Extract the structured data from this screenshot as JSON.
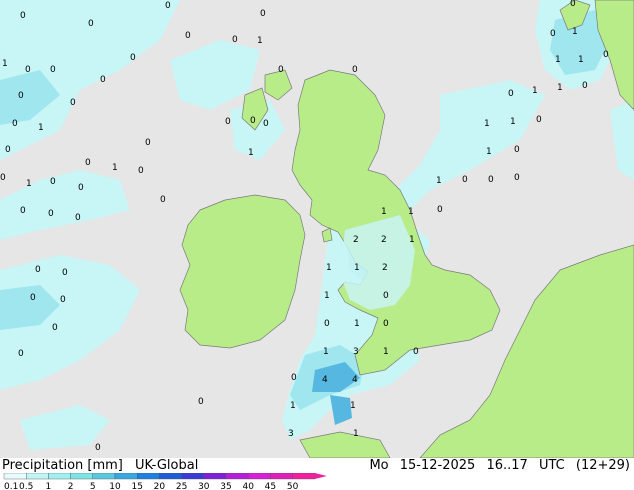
{
  "header": {
    "title": "Precipitation [mm]",
    "model": "UK-Global",
    "day": "Mo",
    "date": "15-12-2025",
    "hours": "16..17",
    "timezone": "UTC",
    "offset": "(12+29)"
  },
  "legend": {
    "ticks": [
      "0.1",
      "0.5",
      "1",
      "2",
      "5",
      "10",
      "15",
      "20",
      "25",
      "30",
      "35",
      "40",
      "45",
      "50"
    ],
    "colors": [
      "#e6fcfc",
      "#bff5f5",
      "#a0f0f0",
      "#7de3e3",
      "#55c9e0",
      "#38a8e0",
      "#1e80df",
      "#1e5cd6",
      "#3a3ad6",
      "#7f1fd6",
      "#b31fd6",
      "#d61fd6",
      "#e01fb8",
      "#f01fa0"
    ]
  },
  "colors": {
    "land": "#b8ec88",
    "sea": "#e6e6e6",
    "precip_light": "#c8f5f5",
    "precip_mid": "#9fe6ef",
    "precip_heavy": "#56b8e0"
  },
  "map_labels": {
    "zero": "0",
    "one": "1",
    "two": "2",
    "three": "3",
    "four": "4"
  }
}
